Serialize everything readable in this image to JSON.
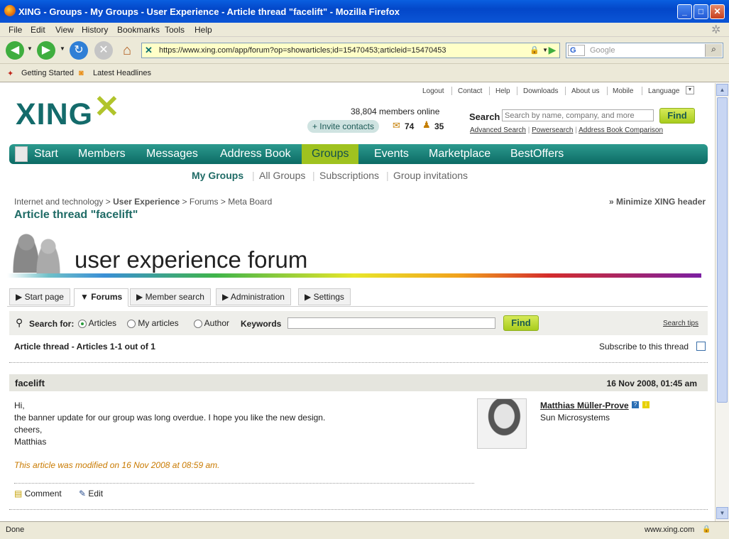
{
  "window": {
    "title": "XING - Groups - My Groups - User Experience - Article thread \"facelift\" - Mozilla Firefox"
  },
  "menu": [
    "File",
    "Edit",
    "View",
    "History",
    "Bookmarks",
    "Tools",
    "Help"
  ],
  "browser": {
    "url": "https://www.xing.com/app/forum?op=showarticles;id=15470453;articleid=15470453",
    "search_placeholder": "Google",
    "search_engine_glyph": "G"
  },
  "bookmarks": [
    "Getting Started",
    "Latest Headlines"
  ],
  "xing": {
    "top_links": [
      "Logout",
      "Contact",
      "Help",
      "Downloads",
      "About us",
      "Mobile",
      "Language"
    ],
    "logo": "XING",
    "members_online": "38,804 members online",
    "invite_label": "+ Invite contacts",
    "messages_count": "74",
    "contacts_count": "35",
    "search_label": "Search",
    "search_placeholder": "Search by name, company, and more",
    "find_label": "Find",
    "search_links": [
      "Advanced Search",
      "Powersearch",
      "Address Book Comparison"
    ],
    "nav": [
      "Start",
      "Members",
      "Messages",
      "Address Book",
      "Groups",
      "Events",
      "Marketplace",
      "BestOffers"
    ],
    "subnav": [
      "My Groups",
      "All Groups",
      "Subscriptions",
      "Group invitations"
    ],
    "breadcrumb": [
      "Internet and technology",
      "User Experience",
      "Forums",
      "Meta Board"
    ],
    "minimize_header": "» Minimize XING header",
    "page_title": "Article thread \"facelift\"",
    "banner_text": "user experience forum",
    "tabs": [
      "Start page",
      "Forums",
      "Member search",
      "Administration",
      "Settings"
    ],
    "search_for_label": "Search for:",
    "search_options": [
      "Articles",
      "My articles",
      "Author"
    ],
    "keywords_label": "Keywords",
    "search_tips": "Search tips",
    "thread_summary": "Article thread - Articles 1-1 out of 1",
    "subscribe_label": "Subscribe to this thread",
    "article": {
      "title": "facelift",
      "date": "16 Nov 2008, 01:45 am",
      "body": [
        "Hi,",
        "the banner update for our group was long overdue. I hope you like the new design.",
        "cheers,",
        "Matthias"
      ],
      "modified_note": "This article was modified on 16 Nov 2008 at 08:59 am.",
      "author": "Matthias Müller-Prove",
      "company": "Sun Microsystems",
      "actions": [
        "Comment",
        "Edit"
      ]
    }
  },
  "status": {
    "left": "Done",
    "right": "www.xing.com"
  },
  "colors": {
    "xing_teal": "#146b6b",
    "xing_green": "#b1c42c",
    "modified": "#c97a00"
  }
}
